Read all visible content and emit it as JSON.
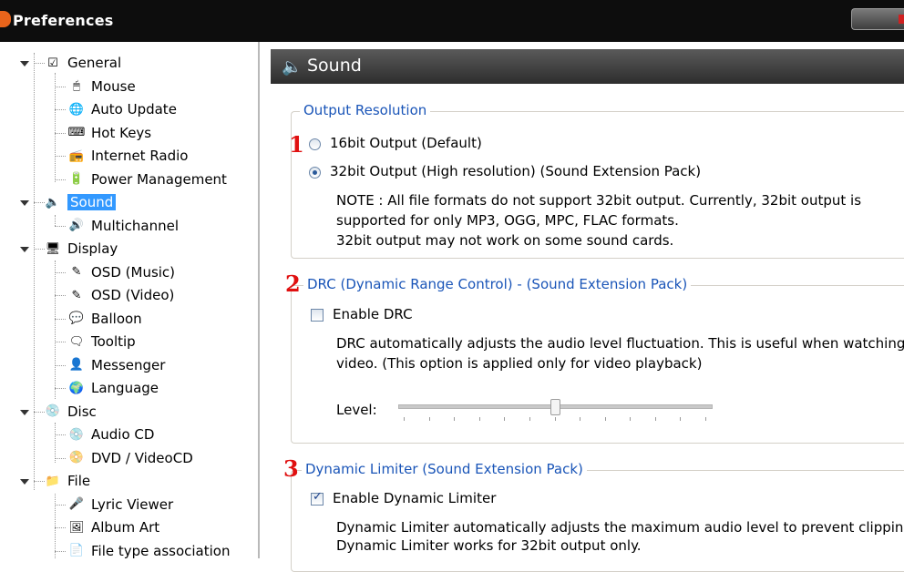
{
  "window": {
    "title": "Preferences"
  },
  "tree": [
    {
      "label": "General",
      "icon": "checkbox-icon",
      "level": 0,
      "expanded": true
    },
    {
      "label": "Mouse",
      "icon": "mouse-icon",
      "level": 1
    },
    {
      "label": "Auto Update",
      "icon": "globe-icon",
      "level": 1
    },
    {
      "label": "Hot Keys",
      "icon": "keyboard-icon",
      "level": 1
    },
    {
      "label": "Internet Radio",
      "icon": "radio-icon",
      "level": 1
    },
    {
      "label": "Power Management",
      "icon": "battery-icon",
      "level": 1
    },
    {
      "label": "Sound",
      "icon": "speaker-icon",
      "level": 0,
      "expanded": true,
      "selected": true
    },
    {
      "label": "Multichannel",
      "icon": "speakers-icon",
      "level": 1
    },
    {
      "label": "Display",
      "icon": "monitor-icon",
      "level": 0,
      "expanded": true
    },
    {
      "label": "OSD (Music)",
      "icon": "osd-icon",
      "level": 1
    },
    {
      "label": "OSD (Video)",
      "icon": "osd-icon",
      "level": 1
    },
    {
      "label": "Balloon",
      "icon": "balloon-icon",
      "level": 1
    },
    {
      "label": "Tooltip",
      "icon": "tooltip-icon",
      "level": 1
    },
    {
      "label": "Messenger",
      "icon": "messenger-icon",
      "level": 1
    },
    {
      "label": "Language",
      "icon": "language-icon",
      "level": 1
    },
    {
      "label": "Disc",
      "icon": "disc-icon",
      "level": 0,
      "expanded": true
    },
    {
      "label": "Audio CD",
      "icon": "cd-icon",
      "level": 1
    },
    {
      "label": "DVD / VideoCD",
      "icon": "dvd-icon",
      "level": 1
    },
    {
      "label": "File",
      "icon": "file-icon",
      "level": 0,
      "expanded": true
    },
    {
      "label": "Lyric Viewer",
      "icon": "lyric-icon",
      "level": 1
    },
    {
      "label": "Album Art",
      "icon": "album-icon",
      "level": 1
    },
    {
      "label": "File type association",
      "icon": "filetype-icon",
      "level": 1
    }
  ],
  "panel": {
    "title": "Sound",
    "output_resolution": {
      "legend": "Output Resolution",
      "marker": "1",
      "option_16": "16bit Output (Default)",
      "option_32": "32bit Output (High resolution) (Sound Extension Pack)",
      "selected": "32bit",
      "note_1": "NOTE : All file formats do not support 32bit output. Currently, 32bit output is",
      "note_2": "supported for only MP3, OGG, MPC, FLAC formats.",
      "note_3": "32bit output may not work on some sound cards."
    },
    "drc": {
      "marker": "2",
      "legend": "DRC (Dynamic Range Control) - (Sound Extension Pack)",
      "enable_label": "Enable DRC",
      "enabled": false,
      "desc_1": "DRC automatically adjusts the audio level fluctuation. This is useful when watching",
      "desc_2": "video. (This option is applied only for video playback)",
      "level_label": "Level:",
      "level_fraction": 0.5
    },
    "limiter": {
      "marker": "3",
      "legend": "Dynamic Limiter (Sound Extension Pack)",
      "enable_label": "Enable Dynamic Limiter",
      "enabled": true,
      "desc_1": "Dynamic Limiter automatically adjusts the maximum audio level to prevent clipping.",
      "desc_2": "Dynamic Limiter works for 32bit output only."
    }
  },
  "colors": {
    "legend": "#1a55b8",
    "marker": "#e01010",
    "selection": "#3399ff"
  }
}
